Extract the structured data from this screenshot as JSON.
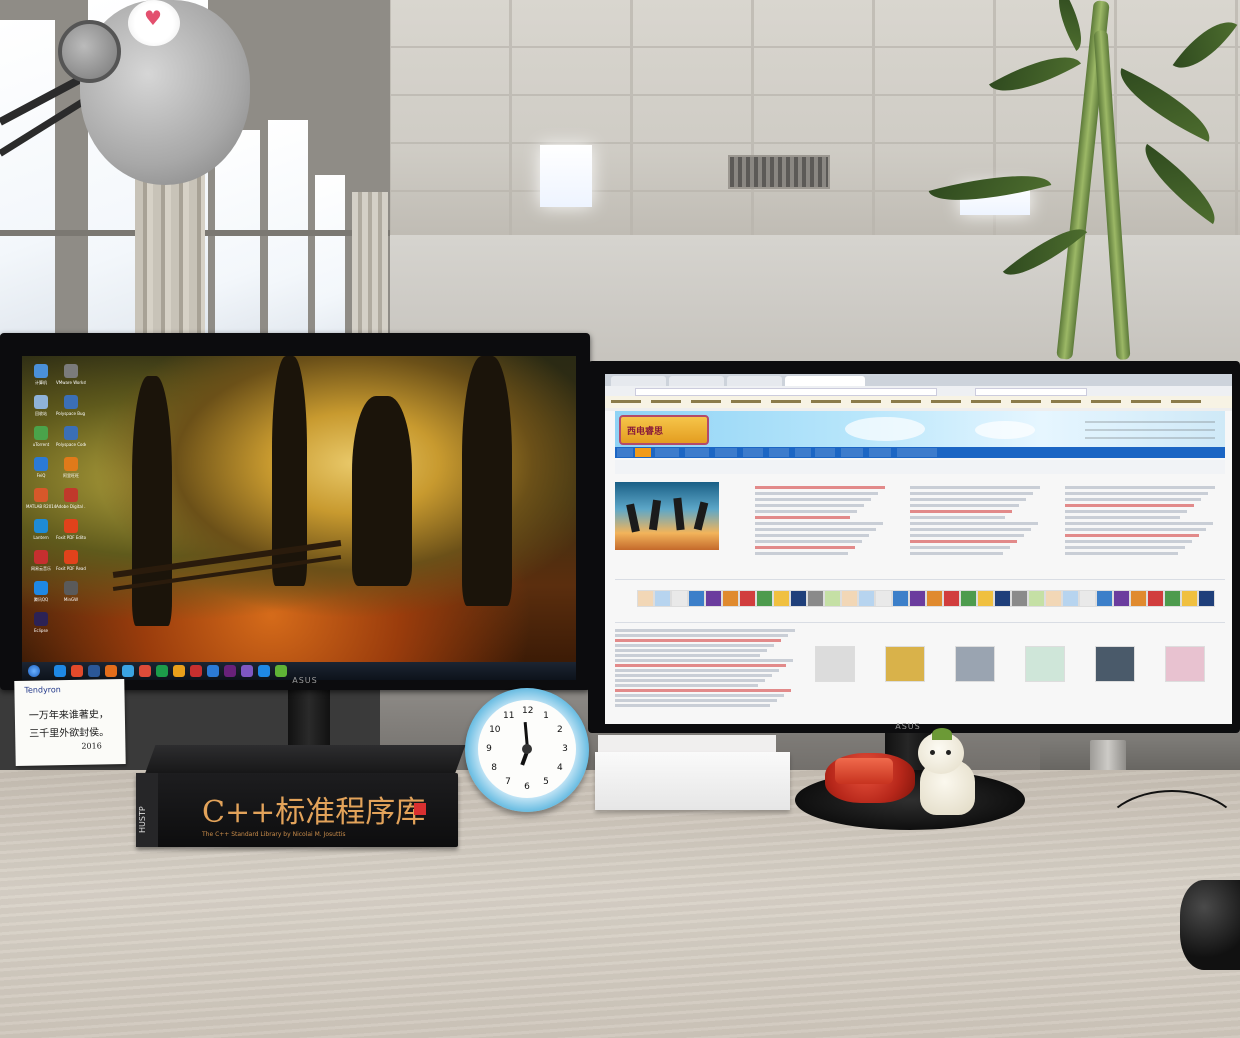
{
  "scene": {
    "type": "photo",
    "subject": "dual-monitor desk setup in an office"
  },
  "left_monitor": {
    "brand": "ASUS",
    "wallpaper": "autumn forest path",
    "desktop_icons": [
      {
        "label": "计算机",
        "color": "#4a90d9"
      },
      {
        "label": "VMware Workstation",
        "color": "#7b7b7b"
      },
      {
        "label": "回收站",
        "color": "#8fb3d9"
      },
      {
        "label": "Polyspace Bug Find...",
        "color": "#3b6fb6"
      },
      {
        "label": "uTorrent",
        "color": "#4aa34a"
      },
      {
        "label": "Polyspace Code Pr...",
        "color": "#3b6fb6"
      },
      {
        "label": "FeiQ",
        "color": "#2b7ad6"
      },
      {
        "label": "阿里旺旺",
        "color": "#e07a1a"
      },
      {
        "label": "MATLAB R2014a",
        "color": "#d7582a"
      },
      {
        "label": "Adobe Digital ...",
        "color": "#c0392b"
      },
      {
        "label": "Lantern",
        "color": "#1e8bd6"
      },
      {
        "label": "Foxit PDF Editor",
        "color": "#e1421b"
      },
      {
        "label": "网易云音乐",
        "color": "#c62f2f"
      },
      {
        "label": "Foxit PDF Reader",
        "color": "#e1421b"
      },
      {
        "label": "腾讯QQ",
        "color": "#1e88e5"
      },
      {
        "label": "MinGW",
        "color": "#5a5a5a"
      },
      {
        "label": "Eclipse",
        "color": "#2c2255"
      }
    ],
    "taskbar_icon_colors": [
      "#1e88e5",
      "#e24a2b",
      "#2b5797",
      "#e36d1b",
      "#3aa3e3",
      "#dd4b39",
      "#1c9c4a",
      "#e9a01b",
      "#c62f2f",
      "#2b7ad6",
      "#68217a",
      "#7e57c2",
      "#1e88e5",
      "#5fb336"
    ]
  },
  "right_monitor": {
    "brand": "ASUS",
    "content": "forum web page in browser",
    "site_logo_text": "西电睿思"
  },
  "book": {
    "spine": "HUSTP",
    "title_cn": "C++标准程序库",
    "subtitle": "The C++ Standard Library by Nicolai M. Josuttis"
  },
  "clock": {
    "numbers": [
      "12",
      "1",
      "2",
      "3",
      "4",
      "5",
      "6",
      "7",
      "8",
      "9",
      "10",
      "11"
    ]
  },
  "sticky_note": {
    "brand": "Tendyron",
    "lines": [
      "一万年来谁著史，",
      "三千里外欲封侯。",
      "2016"
    ]
  },
  "colors": {
    "clock_rim": "#6bbde2",
    "stapler": "#c7331f",
    "site_nav": "#1c66c4",
    "site_accent": "#f29b1a"
  }
}
